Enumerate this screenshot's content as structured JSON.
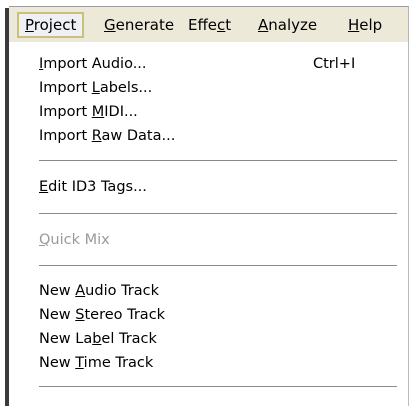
{
  "menubar": {
    "items": [
      {
        "pre": "",
        "u": "P",
        "post": "roject"
      },
      {
        "pre": "",
        "u": "G",
        "post": "enerate"
      },
      {
        "pre": "Effe",
        "u": "c",
        "post": "t"
      },
      {
        "pre": "",
        "u": "A",
        "post": "nalyze"
      },
      {
        "pre": "",
        "u": "H",
        "post": "elp"
      }
    ]
  },
  "dropdown": {
    "items": [
      {
        "pre": "",
        "u": "I",
        "post": "mport Audio...",
        "shortcut": "Ctrl+I"
      },
      {
        "pre": "Import ",
        "u": "L",
        "post": "abels..."
      },
      {
        "pre": "Import ",
        "u": "M",
        "post": "IDI..."
      },
      {
        "pre": "Import ",
        "u": "R",
        "post": "aw Data..."
      },
      {
        "pre": "",
        "u": "E",
        "post": "dit ID3 Tags..."
      },
      {
        "pre": "",
        "u": "Q",
        "post": "uick Mix"
      },
      {
        "pre": "New ",
        "u": "A",
        "post": "udio Track"
      },
      {
        "pre": "New ",
        "u": "S",
        "post": "tereo Track"
      },
      {
        "pre": "New La",
        "u": "b",
        "post": "el Track"
      },
      {
        "pre": "New ",
        "u": "T",
        "post": "ime Track"
      }
    ]
  }
}
